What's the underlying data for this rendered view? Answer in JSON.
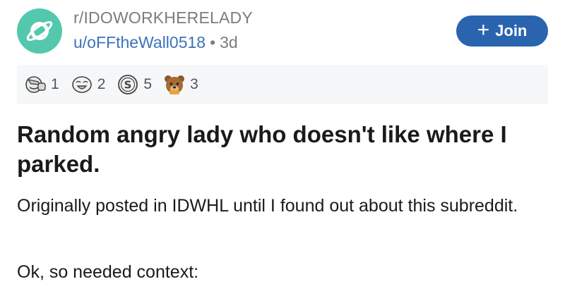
{
  "post": {
    "subreddit": "r/IDOWORKHERELADY",
    "author": "u/oFFtheWall0518",
    "separator": "•",
    "age": "3d",
    "join_label": "Join",
    "join_icon": "+",
    "awards": [
      {
        "icon": "facepalm-award-icon",
        "count": "1"
      },
      {
        "icon": "laughing-face-award-icon",
        "count": "2"
      },
      {
        "icon": "dollar-coin-award-icon",
        "count": "5"
      },
      {
        "icon": "bear-award-icon",
        "count": "3"
      }
    ],
    "title": "Random angry lady who doesn't like where I parked.",
    "body": [
      "Originally posted in IDWHL until I found out about this subreddit.",
      "Ok, so needed context:"
    ]
  },
  "colors": {
    "avatar": "#53c8ad",
    "join_button": "#2a64ae",
    "username": "#3b73b9",
    "meta_gray": "#7c7c7c",
    "awards_bar": "#f6f7f8"
  }
}
